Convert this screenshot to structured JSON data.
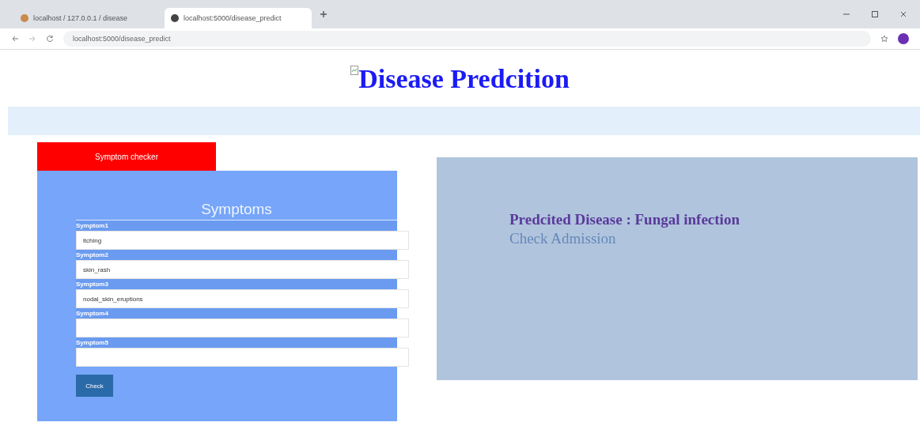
{
  "browser": {
    "tabs": [
      {
        "title": "localhost / 127.0.0.1 / disease",
        "selected": false
      },
      {
        "title": "localhost:5000/disease_predict",
        "selected": true
      }
    ],
    "url": "localhost:5000/disease_predict"
  },
  "page_title": "Disease Predcition",
  "tabs": [
    {
      "label": "Symptom checker",
      "selected": true
    }
  ],
  "form": {
    "heading": "Symptoms",
    "fields": [
      {
        "label": "Symptom1",
        "value": "itching"
      },
      {
        "label": "Symptom2",
        "value": "skin_rash"
      },
      {
        "label": "Symptom3",
        "value": "nodal_skin_eruptions"
      },
      {
        "label": "Symptom4"
      },
      {
        "label": "Symptom5"
      }
    ],
    "button": "Check"
  },
  "result": {
    "prediction": "Predcited Disease : Fungal infection",
    "link": "Check Admission"
  }
}
